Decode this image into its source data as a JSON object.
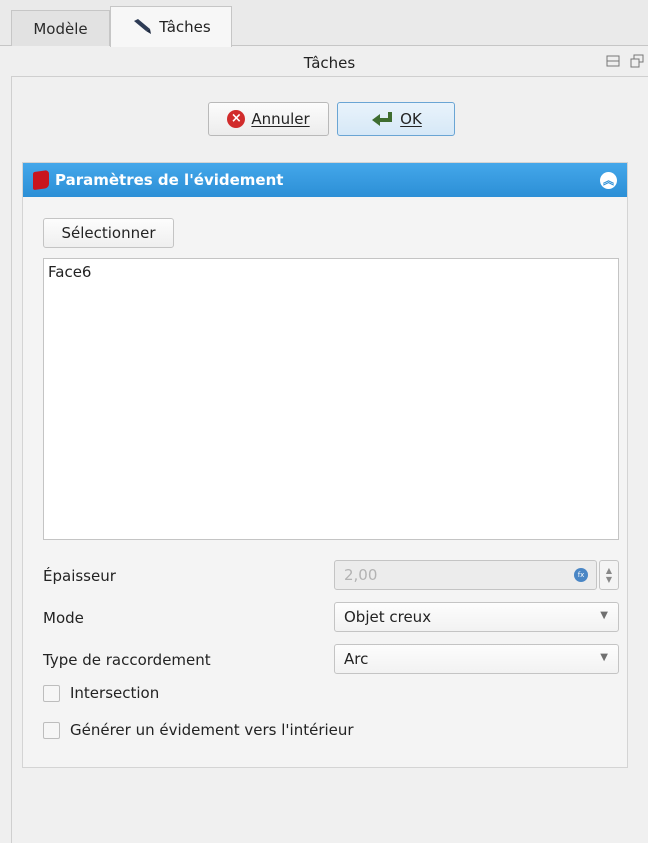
{
  "tabs": [
    {
      "label": "Modèle"
    },
    {
      "label": "Tâches"
    }
  ],
  "dock": {
    "title": "Tâches"
  },
  "actions": {
    "cancel_label": "Annuler",
    "ok_label": "OK"
  },
  "section": {
    "title": "Paramètres de l'évidement",
    "select_label": "Sélectionner",
    "faces": [
      "Face6"
    ],
    "thickness": {
      "label": "Épaisseur",
      "value": "2,00"
    },
    "mode": {
      "label": "Mode",
      "value": "Objet creux"
    },
    "join_type": {
      "label": "Type de raccordement",
      "value": "Arc"
    },
    "intersection": {
      "label": "Intersection",
      "checked": false
    },
    "inward": {
      "label": "Générer un évidement vers l'intérieur",
      "checked": false
    }
  },
  "icons": {
    "tasks_tab": "pen-icon",
    "cancel": "cancel-icon",
    "ok": "ok-arrow-icon",
    "section": "thickness-tool-icon",
    "collapse": "collapse-up-icon"
  },
  "colors": {
    "header_blue": "#2c8fd6",
    "cancel_red": "#d12c2c"
  }
}
